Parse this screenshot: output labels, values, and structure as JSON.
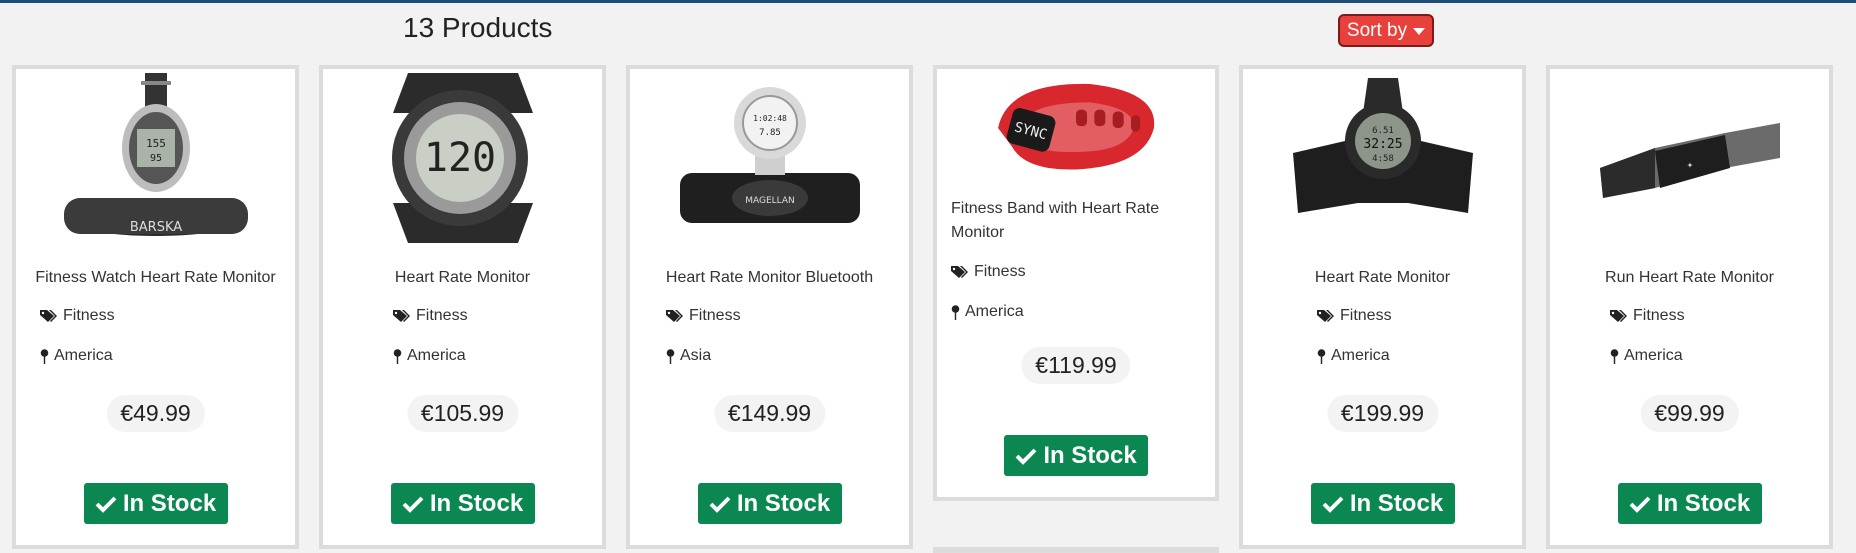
{
  "header": {
    "product_count": "13 Products",
    "sort_label": "Sort by"
  },
  "products": [
    {
      "title": "Fitness Watch Heart Rate Monitor",
      "category": "Fitness",
      "region": "America",
      "price": "€49.99",
      "stock": "In Stock",
      "image_icon": "barska-watch-image"
    },
    {
      "title": "Heart Rate Monitor",
      "category": "Fitness",
      "region": "America",
      "price": "€105.99",
      "stock": "In Stock",
      "image_icon": "round-watch-image"
    },
    {
      "title": "Heart Rate Monitor Bluetooth",
      "category": "Fitness",
      "region": "Asia",
      "price": "€149.99",
      "stock": "In Stock",
      "image_icon": "magellan-strap-image"
    },
    {
      "title": "Fitness Band with Heart Rate Monitor",
      "category": "Fitness",
      "region": "America",
      "price": "€119.99",
      "stock": "In Stock",
      "image_icon": "red-band-image"
    },
    {
      "title": "Heart Rate Monitor",
      "category": "Fitness",
      "region": "America",
      "price": "€199.99",
      "stock": "In Stock",
      "image_icon": "garmin-watch-image"
    },
    {
      "title": "Run Heart Rate Monitor",
      "category": "Fitness",
      "region": "America",
      "price": "€99.99",
      "stock": "In Stock",
      "image_icon": "chest-strap-image"
    }
  ],
  "colors": {
    "accent_red": "#e8413c",
    "stock_green": "#0b8752",
    "top_bar": "#1f4e79"
  }
}
